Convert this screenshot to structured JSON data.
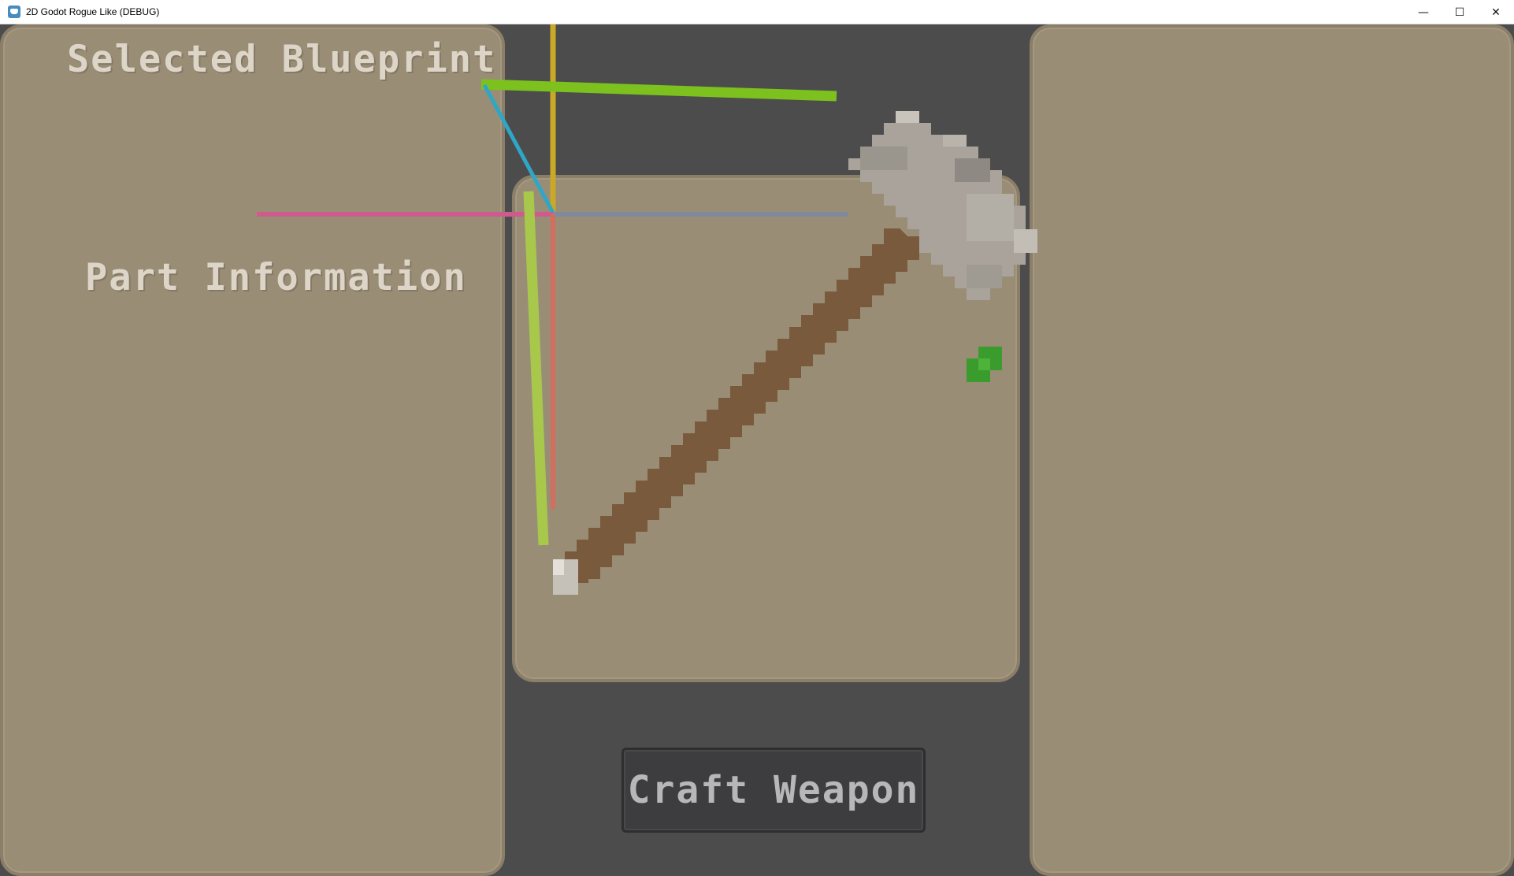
{
  "window": {
    "title": "2D Godot Rogue Like (DEBUG)",
    "controls": {
      "minimize": "—",
      "maximize": "☐",
      "close": "✕"
    }
  },
  "left_panel": {
    "heading": "Selected Blueprint",
    "subheading": "Part Information"
  },
  "craft_button": {
    "label": "Craft Weapon"
  },
  "colors": {
    "panel": "#9a8d76",
    "background": "#4c4c4c",
    "axe_handle": "#7a5a3c",
    "axe_head": "#a9a39b",
    "debug_green": "#3a9c2c"
  },
  "icons": [
    "godot-app-icon",
    "axe-sprite",
    "gizmo-axes"
  ]
}
